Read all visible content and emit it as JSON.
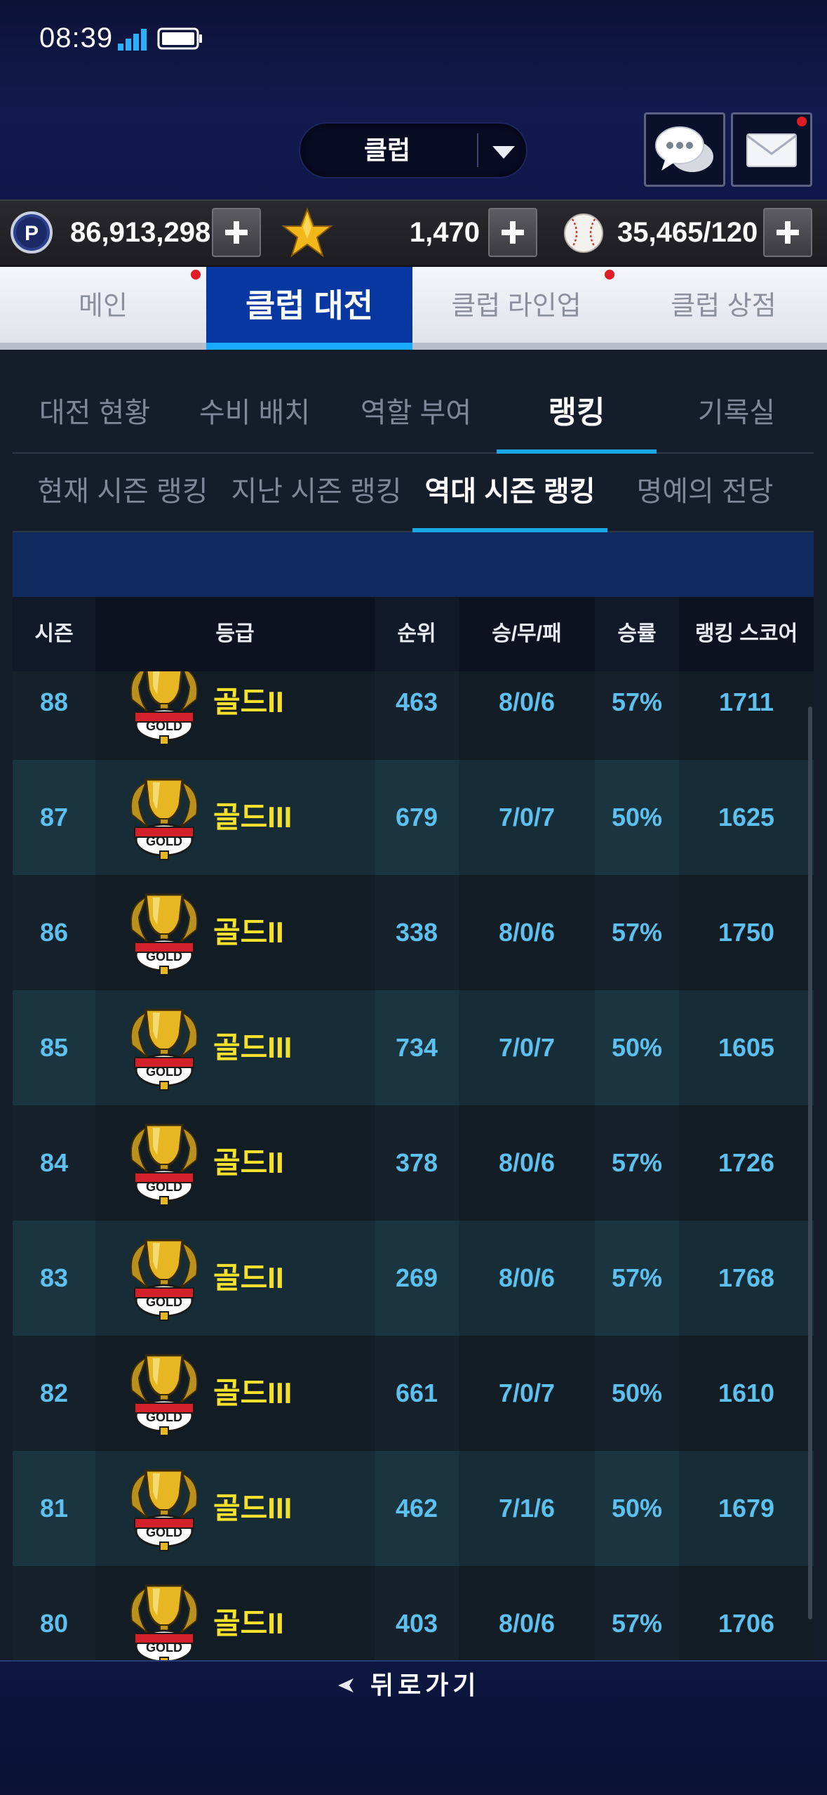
{
  "status_bar": {
    "time": "08:39"
  },
  "header": {
    "club_selector_label": "클럽"
  },
  "currency": {
    "points": "86,913,298",
    "stars": "1,470",
    "balls": "35,465/120"
  },
  "main_tabs": [
    "메인",
    "클럽 대전",
    "클럽 라인업",
    "클럽 상점"
  ],
  "sub_tabs": [
    "대전 현황",
    "수비 배치",
    "역할 부여",
    "랭킹",
    "기록실"
  ],
  "ranking_tabs": [
    "현재 시즌 랭킹",
    "지난 시즌 랭킹",
    "역대 시즌 랭킹",
    "명예의 전당"
  ],
  "table": {
    "headers": {
      "season": "시즌",
      "grade": "등급",
      "rank": "순위",
      "record": "승/무/패",
      "win_rate": "승률",
      "score": "랭킹 스코어"
    },
    "rows": [
      {
        "season": "88",
        "grade": "골드II",
        "rank": "463",
        "record": "8/0/6",
        "win_rate": "57%",
        "score": "1711"
      },
      {
        "season": "87",
        "grade": "골드III",
        "rank": "679",
        "record": "7/0/7",
        "win_rate": "50%",
        "score": "1625"
      },
      {
        "season": "86",
        "grade": "골드II",
        "rank": "338",
        "record": "8/0/6",
        "win_rate": "57%",
        "score": "1750"
      },
      {
        "season": "85",
        "grade": "골드III",
        "rank": "734",
        "record": "7/0/7",
        "win_rate": "50%",
        "score": "1605"
      },
      {
        "season": "84",
        "grade": "골드II",
        "rank": "378",
        "record": "8/0/6",
        "win_rate": "57%",
        "score": "1726"
      },
      {
        "season": "83",
        "grade": "골드II",
        "rank": "269",
        "record": "8/0/6",
        "win_rate": "57%",
        "score": "1768"
      },
      {
        "season": "82",
        "grade": "골드III",
        "rank": "661",
        "record": "7/0/7",
        "win_rate": "50%",
        "score": "1610"
      },
      {
        "season": "81",
        "grade": "골드III",
        "rank": "462",
        "record": "7/1/6",
        "win_rate": "50%",
        "score": "1679"
      },
      {
        "season": "80",
        "grade": "골드II",
        "rank": "403",
        "record": "8/0/6",
        "win_rate": "57%",
        "score": "1706"
      }
    ]
  },
  "badge": {
    "text": "GOLD"
  },
  "footer": {
    "back_label": "뒤로가기"
  },
  "colors": {
    "accent": "#1aa7e6",
    "active_tab": "#0738a2",
    "tier_text": "#f5e12c",
    "cell_text": "#5ec0ee",
    "notification_dot": "#e01c24"
  },
  "icons": {
    "chat": "chat-bubble-icon",
    "mail": "envelope-icon",
    "points": "p-coin-icon",
    "stars": "star-icon",
    "balls": "baseball-icon",
    "back": "back-arrow-icon"
  }
}
